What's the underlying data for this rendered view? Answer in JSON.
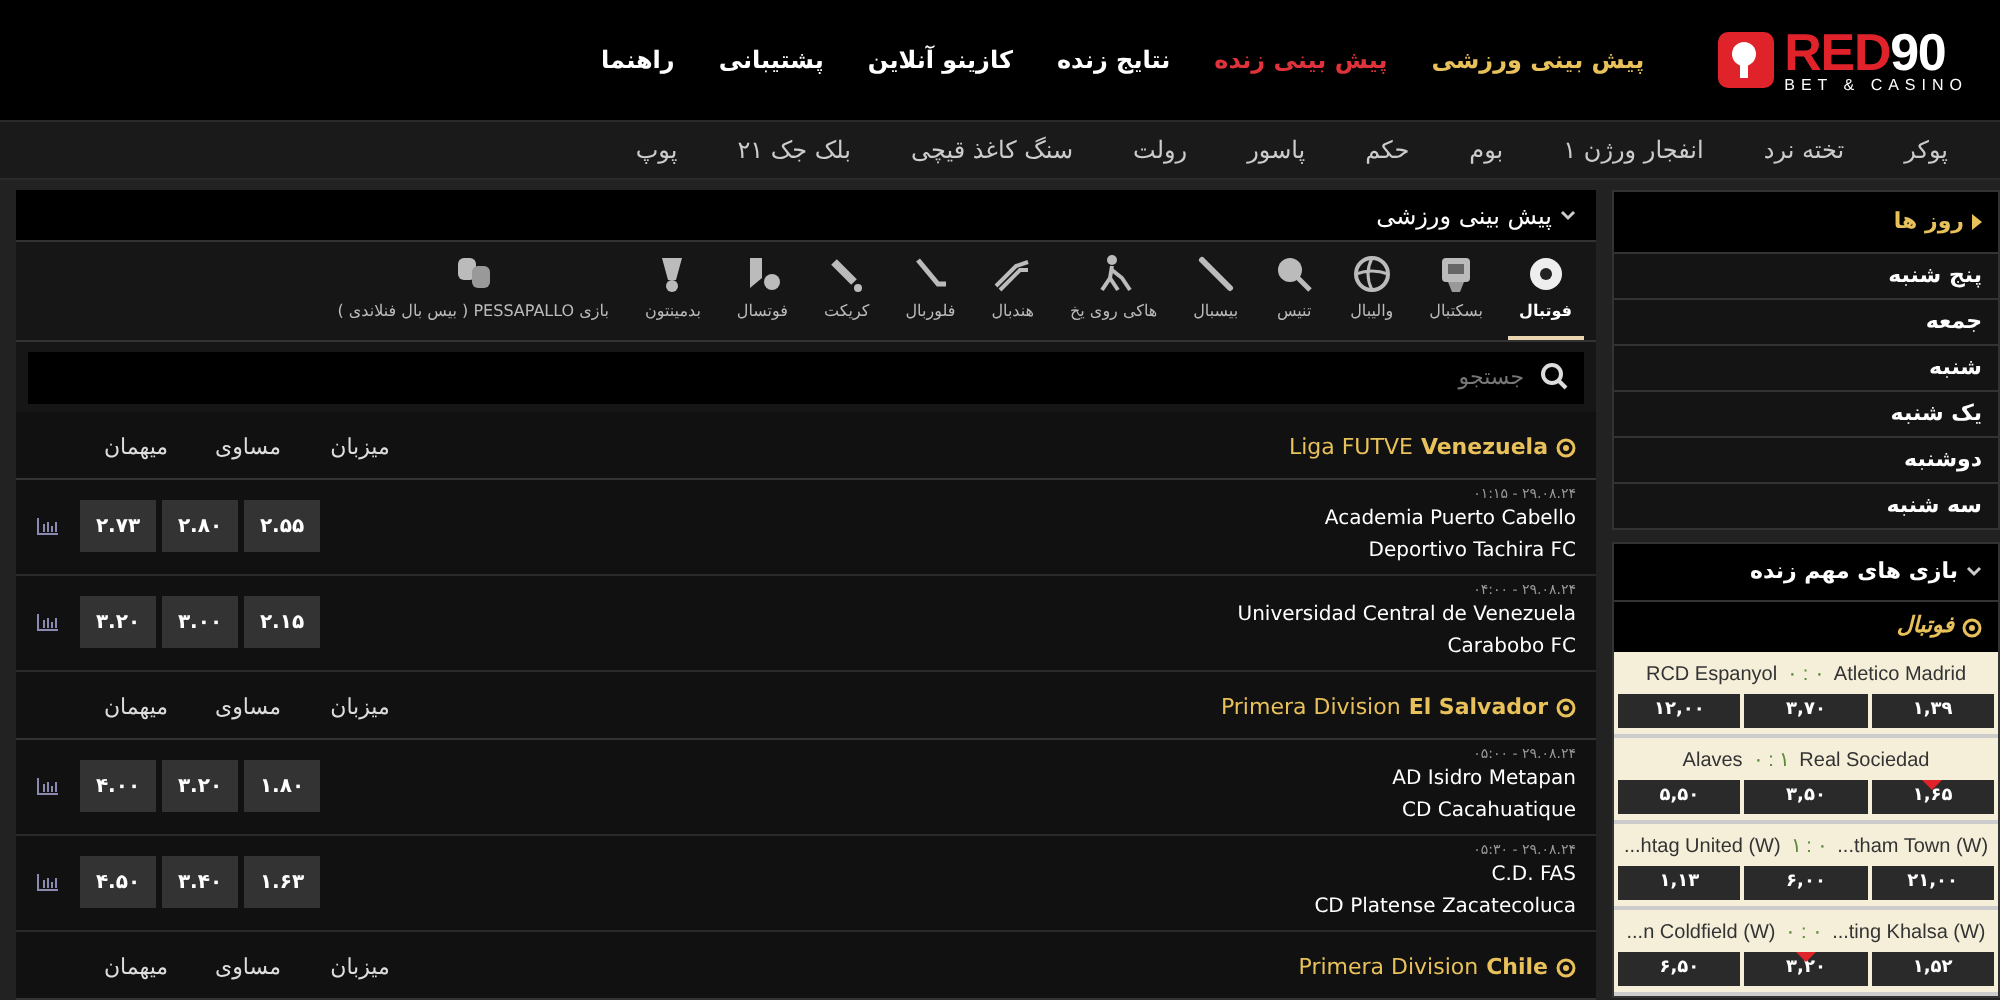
{
  "logo": {
    "word_a": "RED",
    "word_b": "90",
    "tagline": "BET & CASINO"
  },
  "nav": [
    {
      "label": "پیش بینی ورزشی",
      "color": "#e8c15a"
    },
    {
      "label": "پیش بینی زنده",
      "color": "#e0323a"
    },
    {
      "label": "نتایج زنده",
      "color": "#ffffff"
    },
    {
      "label": "کازینو آنلاین",
      "color": "#ffffff"
    },
    {
      "label": "پشتیبانی",
      "color": "#ffffff"
    },
    {
      "label": "راهنما",
      "color": "#ffffff"
    }
  ],
  "games": [
    "پوکر",
    "تخته نرد",
    "انفجار ورژن ۱",
    "بوم",
    "حکم",
    "پاسور",
    "رولت",
    "سنگ کاغذ قیچی",
    "بلک جک ۲۱",
    "پوپ"
  ],
  "main": {
    "title": "پیش بینی ورزشی",
    "sports": [
      {
        "label": "فوتبال",
        "selected": true
      },
      {
        "label": "بسکتبال",
        "selected": false
      },
      {
        "label": "والیبال",
        "selected": false
      },
      {
        "label": "تنیس",
        "selected": false
      },
      {
        "label": "بیسبال",
        "selected": false
      },
      {
        "label": "هاکی روی یخ",
        "selected": false
      },
      {
        "label": "هندبال",
        "selected": false
      },
      {
        "label": "فلوربال",
        "selected": false
      },
      {
        "label": "کریکت",
        "selected": false
      },
      {
        "label": "فوتسال",
        "selected": false
      },
      {
        "label": "بدمینتون",
        "selected": false
      },
      {
        "label": "بازی PESSAPALLO ( بیس بال فنلاندی )",
        "selected": false
      }
    ],
    "search": {
      "placeholder": "جستجو"
    },
    "leagues": [
      {
        "name": "Liga FUTVE",
        "country": "Venezuela",
        "columns": [
          "میزبان",
          "مساوی",
          "میهمان"
        ],
        "matches": [
          {
            "time": "۰۱:۱۵ - ۲۹.۰۸.۲۴",
            "home": "Academia Puerto Cabello",
            "away": "Deportivo Tachira FC",
            "odds": [
              "۲.۵۵",
              "۲.۸۰",
              "۲.۷۳"
            ]
          },
          {
            "time": "۰۴:۰۰ - ۲۹.۰۸.۲۴",
            "home": "Universidad Central de Venezuela",
            "away": "Carabobo FC",
            "odds": [
              "۲.۱۵",
              "۳.۰۰",
              "۳.۲۰"
            ]
          }
        ]
      },
      {
        "name": "Primera Division",
        "country": "El Salvador",
        "columns": [
          "میزبان",
          "مساوی",
          "میهمان"
        ],
        "matches": [
          {
            "time": "۰۵:۰۰ - ۲۹.۰۸.۲۴",
            "home": "AD Isidro Metapan",
            "away": "CD Cacahuatique",
            "odds": [
              "۱.۸۰",
              "۳.۲۰",
              "۴.۰۰"
            ]
          },
          {
            "time": "۰۵:۳۰ - ۲۹.۰۸.۲۴",
            "home": "C.D. FAS",
            "away": "CD Platense Zacatecoluca",
            "odds": [
              "۱.۶۳",
              "۳.۴۰",
              "۴.۵۰"
            ]
          }
        ]
      },
      {
        "name": "Primera Division",
        "country": "Chile",
        "columns": [
          "میزبان",
          "مساوی",
          "میهمان"
        ]
      }
    ]
  },
  "days": {
    "title": "روز ها",
    "items": [
      "پنج شنبه",
      "جمعه",
      "شنبه",
      "یک شنبه",
      "دوشنبه",
      "سه شنبه"
    ]
  },
  "live": {
    "title": "بازی های مهم زنده",
    "sport": "فوتبال",
    "matches": [
      {
        "home": "Atletico Madrid",
        "away": "RCD Espanyol",
        "score": "۰ : ۰",
        "odds": [
          {
            "value": "۱,۳۹",
            "dropped": false
          },
          {
            "value": "۳,۷۰",
            "dropped": false
          },
          {
            "value": "۱۲,۰۰",
            "dropped": false
          }
        ]
      },
      {
        "home": "Real Sociedad",
        "away": "Alaves",
        "score": "۰ : ۱",
        "odds": [
          {
            "value": "۱,۶۵",
            "dropped": true
          },
          {
            "value": "۳,۵۰",
            "dropped": false
          },
          {
            "value": "۵,۵۰",
            "dropped": false
          }
        ]
      },
      {
        "home": "...tham Town (W)",
        "away": "...htag United (W)",
        "score": "۱ : ۰",
        "odds": [
          {
            "value": "۲۱,۰۰",
            "dropped": false
          },
          {
            "value": "۶,۰۰",
            "dropped": false
          },
          {
            "value": "۱,۱۳",
            "dropped": false
          }
        ]
      },
      {
        "home": "...ting Khalsa (W)",
        "away": "...n Coldfield (W)",
        "score": "۰ : ۰",
        "odds": [
          {
            "value": "۱,۵۲",
            "dropped": false
          },
          {
            "value": "۳,۲۰",
            "dropped": true
          },
          {
            "value": "۶,۵۰",
            "dropped": false
          }
        ]
      }
    ]
  }
}
